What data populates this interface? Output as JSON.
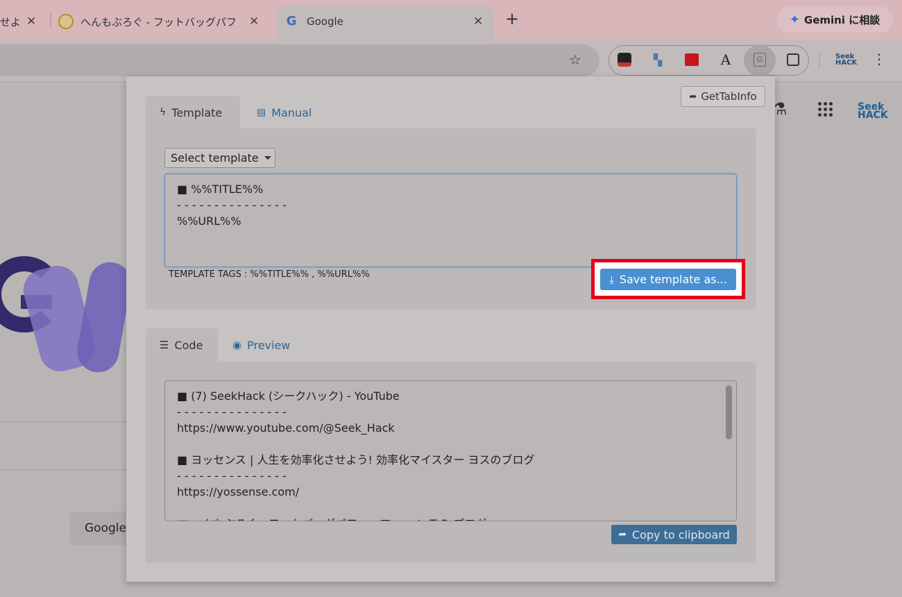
{
  "browser": {
    "tabs": [
      {
        "title": "せよ",
        "favicon": "none"
      },
      {
        "title": "へんもぶろぐ - フットバッグパフ",
        "favicon": "footbag-icon"
      },
      {
        "title": "Google",
        "favicon": "google-icon"
      }
    ],
    "new_tab": "+",
    "close_glyph": "✕",
    "gemini_label": "Gemini に相談",
    "extensions": [
      "notebook-ext-icon",
      "binoculars-ext-icon",
      "speech-ext-icon",
      "font-ext-icon",
      "gettabinfo-ext-icon",
      "puzzle-icon"
    ],
    "profile_ext_label": "Seek HACK"
  },
  "google": {
    "button_label": "Google",
    "corner_label": "Seek HACK"
  },
  "popup": {
    "gettab_button": "GetTabInfo",
    "top_tabs": {
      "template": "Template",
      "manual": "Manual"
    },
    "select_label": "Select template",
    "template_text": "■ %%TITLE%%\n- - - - - - - - - - - - - - -\n%%URL%%",
    "template_tags": "TEMPLATE TAGS : %%TITLE%% , %%URL%%",
    "save_button": "Save template as...",
    "bottom_tabs": {
      "code": "Code",
      "preview": "Preview"
    },
    "code_text": "■ (7) SeekHack (シークハック) - YouTube\n- - - - - - - - - - - - - - -\nhttps://www.youtube.com/@Seek_Hack\n\n■ ヨッセンス | 人生を効率化させよう! 効率化マイスター ヨスのブログ\n- - - - - - - - - - - - - - -\nhttps://yossense.com/\n\n■ へんもぶろぐ - フットバッグパフォーマー ヘンモの ブログ",
    "copy_button": "Copy to clipboard"
  },
  "colors": {
    "highlight": "#e3001b",
    "save_button": "#4a90d0",
    "copy_button": "#3e6d96",
    "link": "#31648e"
  }
}
